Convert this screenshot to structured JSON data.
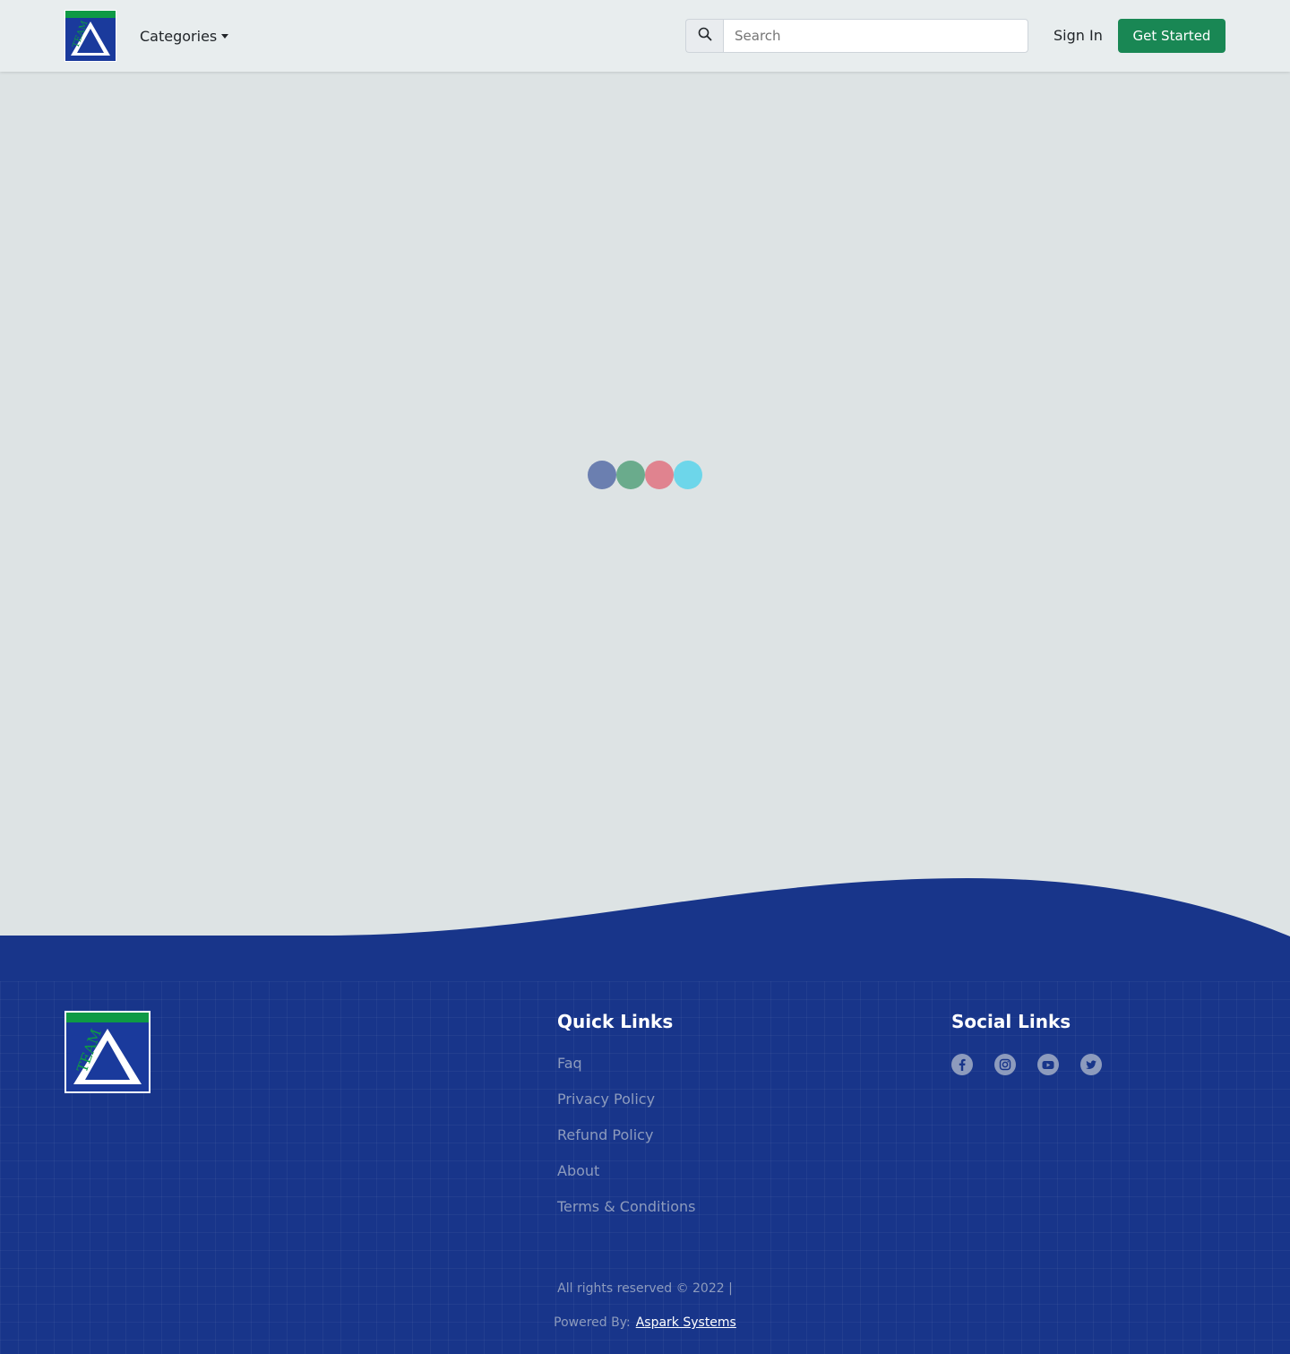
{
  "nav": {
    "logo_alt": "Team Aspark logo",
    "logo_text_top": "TEAM",
    "logo_text_est": "Estd. 2008",
    "categories_label": "Categories",
    "search_placeholder": "Search",
    "signin_label": "Sign In",
    "get_started_label": "Get Started"
  },
  "loader": {
    "colors": [
      "#6b7fb0",
      "#6aab8c",
      "#e0838f",
      "#6dd6ea"
    ]
  },
  "colors": {
    "brand_blue": "#18358a",
    "brand_green": "#198754",
    "logo_green": "#0e9a45",
    "page_bg": "#dde3e4"
  },
  "footer": {
    "quick_links_heading": "Quick Links",
    "quick_links": [
      "Faq",
      "Privacy Policy",
      "Refund Policy",
      "About",
      "Terms & Conditions"
    ],
    "social_heading": "Social Links",
    "social_icons": [
      "facebook-icon",
      "instagram-icon",
      "youtube-icon",
      "twitter-icon"
    ],
    "copyright": "All rights reserved © 2022 |",
    "powered_by_label": "Powered By:",
    "powered_by_link": "Aspark Systems"
  }
}
